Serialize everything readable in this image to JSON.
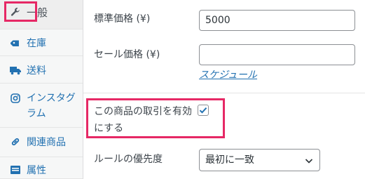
{
  "sidebar": {
    "items": [
      {
        "label": "一般",
        "icon": "wrench-icon"
      },
      {
        "label": "在庫",
        "icon": "tag-icon"
      },
      {
        "label": "送料",
        "icon": "truck-icon"
      },
      {
        "label": "インスタグ\nラム",
        "icon": "instagram-icon"
      },
      {
        "label": "関連商品",
        "icon": "link-icon"
      },
      {
        "label": "属性",
        "icon": "list-icon"
      }
    ]
  },
  "form": {
    "regular_price": {
      "label": "標準価格 (¥)",
      "value": "5000"
    },
    "sale_price": {
      "label": "セール価格 (¥)",
      "value": ""
    },
    "schedule_link": "スケジュール",
    "enable_trading": {
      "label_line1": "この商品の取引を有効",
      "label_line2": "にする",
      "checked": true
    },
    "rule_priority": {
      "label": "ルールの優先度",
      "selected": "最初に一致"
    }
  },
  "colors": {
    "accent": "#2271b1",
    "highlight": "#e62865"
  }
}
